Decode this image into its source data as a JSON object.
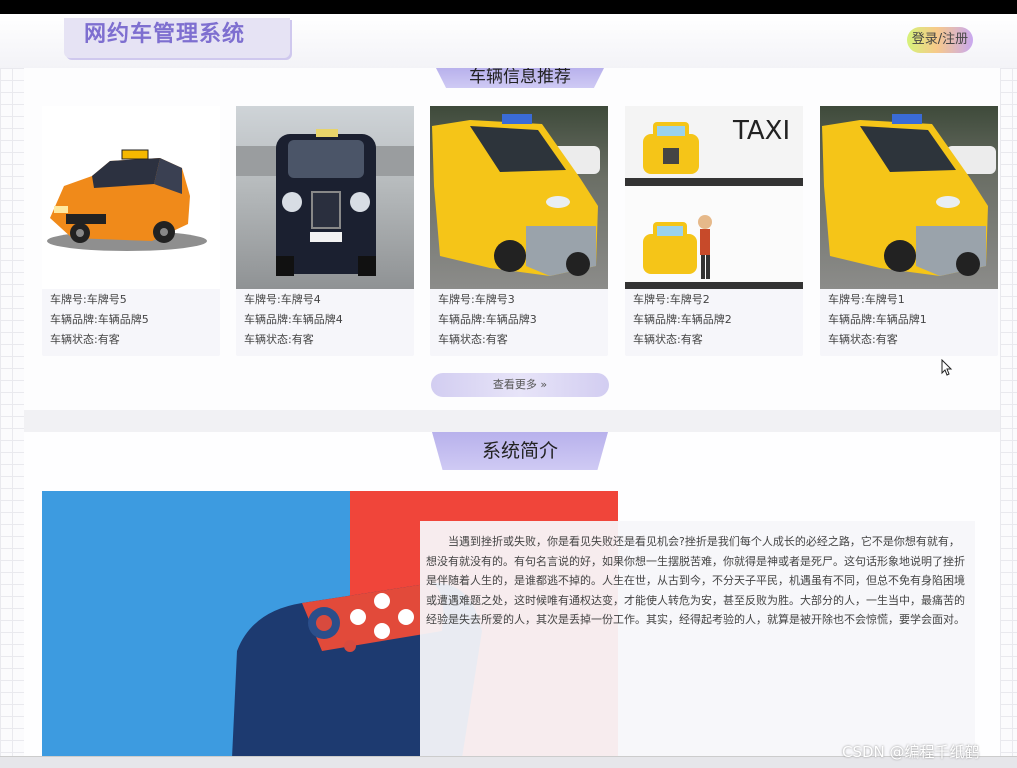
{
  "header": {
    "logo_text": "网约车管理系统",
    "login_label": "登录/注册"
  },
  "vehicles": {
    "section_title": "车辆信息推荐",
    "more_label": "查看更多 »",
    "cards": [
      {
        "plate": "车牌号:车牌号5",
        "brand": "车辆品牌:车辆品牌5",
        "status": "车辆状态:有客"
      },
      {
        "plate": "车牌号:车牌号4",
        "brand": "车辆品牌:车辆品牌4",
        "status": "车辆状态:有客"
      },
      {
        "plate": "车牌号:车牌号3",
        "brand": "车辆品牌:车辆品牌3",
        "status": "车辆状态:有客"
      },
      {
        "plate": "车牌号:车牌号2",
        "brand": "车辆品牌:车辆品牌2",
        "status": "车辆状态:有客"
      },
      {
        "plate": "车牌号:车牌号1",
        "brand": "车辆品牌:车辆品牌1",
        "status": "车辆状态:有客"
      }
    ],
    "taxi_sign": "TAXI"
  },
  "intro": {
    "section_title": "系统简介",
    "text": "当遇到挫折或失败，你是看见失败还是看见机会?挫折是我们每个人成长的必经之路，它不是你想有就有，想没有就没有的。有句名言说的好，如果你想一生摆脱苦难，你就得是神或者是死尸。这句话形象地说明了挫折是伴随着人生的，是谁都逃不掉的。人生在世，从古到今，不分天子平民，机遇虽有不同，但总不免有身陷困境或遭遇难题之处，这时候唯有通权达变，才能使人转危为安，甚至反败为胜。大部分的人，一生当中，最痛苦的经验是失去所爱的人，其次是丢掉一份工作。其实，经得起考验的人，就算是被开除也不会惊慌，要学会面对。"
  },
  "watermark": "CSDN @编程千纸鹤",
  "colors": {
    "accent": "#7e6fd0",
    "tab": "#c2bcf0",
    "taxi_yellow": "#f5c518",
    "intro_blue": "#3d9be0",
    "intro_red": "#f0453a"
  }
}
